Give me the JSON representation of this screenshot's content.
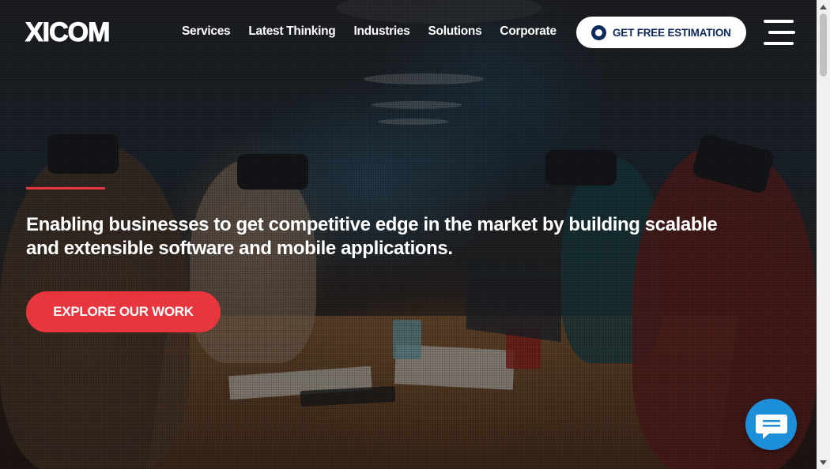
{
  "brand": {
    "logo_text": "XICOM"
  },
  "nav": {
    "items": [
      {
        "label": "Services"
      },
      {
        "label": "Latest Thinking"
      },
      {
        "label": "Industries"
      },
      {
        "label": "Solutions"
      },
      {
        "label": "Corporate"
      }
    ]
  },
  "cta": {
    "label": "GET FREE ESTIMATION",
    "icon": "circle-target-icon",
    "text_color": "#0c2a5a",
    "background": "#ffffff"
  },
  "menu": {
    "icon": "hamburger-menu-icon"
  },
  "hero": {
    "headline": "Enabling businesses to get competitive edge in the market by building scalable and extensible software and mobile applications.",
    "accent_color": "#e8363e",
    "button_label": "EXPLORE OUR WORK",
    "button_color": "#e8363e"
  },
  "chat": {
    "icon": "chat-bubble-icon",
    "color": "#1d8fd9"
  },
  "scrollbar": {
    "up_icon": "scroll-up-arrow-icon",
    "down_icon": "scroll-down-arrow-icon"
  }
}
